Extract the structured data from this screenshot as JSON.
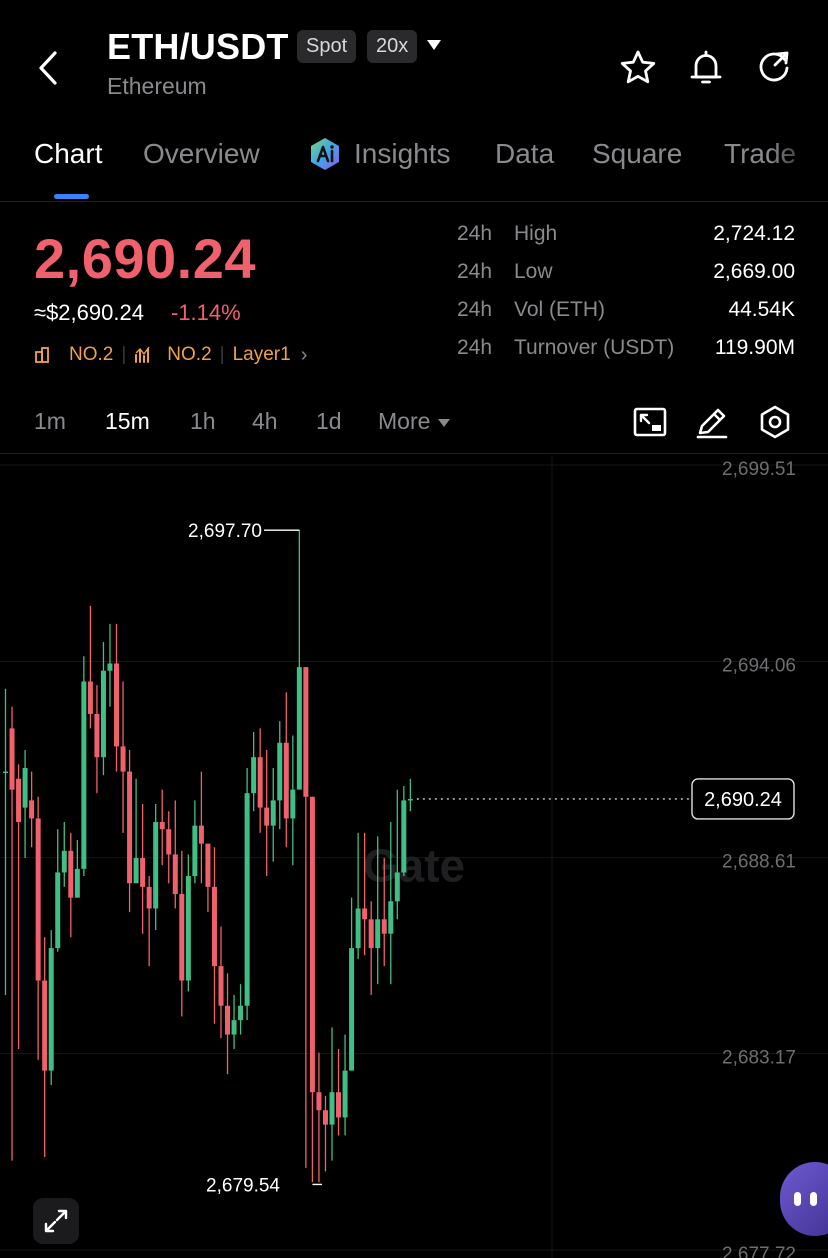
{
  "header": {
    "pair": "ETH/USDT",
    "market_badge": "Spot",
    "leverage_badge": "20x",
    "name": "Ethereum",
    "icons": [
      "back-arrow-icon",
      "star-icon",
      "bell-icon",
      "share-icon"
    ]
  },
  "tabs": [
    {
      "label": "Chart",
      "active": true
    },
    {
      "label": "Overview"
    },
    {
      "label": "Insights",
      "icon": "ai-icon"
    },
    {
      "label": "Data"
    },
    {
      "label": "Square"
    },
    {
      "label": "Trade"
    }
  ],
  "price": {
    "last": "2,690.24",
    "usd": "≈$2,690.24",
    "change_pct": "-1.14%",
    "rank_mcap": "NO.2",
    "rank_vol": "NO.2",
    "category": "Layer1",
    "down_color": "#f0616d",
    "up_color": "#3fbf85"
  },
  "stats": [
    {
      "period": "24h",
      "label": "High",
      "value": "2,724.12"
    },
    {
      "period": "24h",
      "label": "Low",
      "value": "2,669.00"
    },
    {
      "period": "24h",
      "label": "Vol (ETH)",
      "value": "44.54K"
    },
    {
      "period": "24h",
      "label": "Turnover (USDT)",
      "value": "119.90M"
    }
  ],
  "intervals": [
    {
      "label": "1m"
    },
    {
      "label": "15m",
      "active": true
    },
    {
      "label": "1h"
    },
    {
      "label": "4h"
    },
    {
      "label": "1d"
    },
    {
      "label": "More"
    }
  ],
  "toolbar_icons": [
    "indicator-icon",
    "draw-pencil-icon",
    "settings-hex-icon"
  ],
  "chart_data": {
    "type": "candlestick",
    "interval": "15m",
    "y_ticks": [
      "2,699.51",
      "2,694.06",
      "2,688.61",
      "2,683.17",
      "2,677.72"
    ],
    "ylim": [
      2677.72,
      2699.51
    ],
    "last_price_label": "2,690.24",
    "last_price": 2690.24,
    "high_marker": {
      "label": "2,697.70",
      "value": 2697.7
    },
    "low_marker": {
      "label": "2,679.54",
      "value": 2679.54
    },
    "watermark": "Gate",
    "candles": [
      [
        2691.0,
        2691.0,
        2693.3,
        2684.8
      ],
      [
        2692.2,
        2690.5,
        2692.8,
        2680.2
      ],
      [
        2690.8,
        2689.6,
        2691.2,
        2683.3
      ],
      [
        2690.0,
        2691.1,
        2691.6,
        2688.6
      ],
      [
        2690.2,
        2689.7,
        2691.0,
        2688.9
      ],
      [
        2689.7,
        2685.2,
        2690.3,
        2683.0
      ],
      [
        2685.2,
        2682.7,
        2686.4,
        2680.3
      ],
      [
        2682.7,
        2686.1,
        2686.6,
        2682.3
      ],
      [
        2686.1,
        2688.2,
        2689.4,
        2686.0
      ],
      [
        2688.2,
        2688.8,
        2689.6,
        2687.8
      ],
      [
        2688.8,
        2687.5,
        2689.3,
        2686.4
      ],
      [
        2687.5,
        2688.3,
        2689.1,
        2687.9
      ],
      [
        2688.3,
        2693.5,
        2694.2,
        2688.1
      ],
      [
        2693.5,
        2692.6,
        2695.6,
        2692.2
      ],
      [
        2692.6,
        2691.4,
        2693.4,
        2690.4
      ],
      [
        2691.4,
        2693.8,
        2694.6,
        2690.9
      ],
      [
        2693.8,
        2694.0,
        2695.1,
        2692.8
      ],
      [
        2694.0,
        2691.7,
        2695.1,
        2691.0
      ],
      [
        2691.7,
        2691.0,
        2693.5,
        2689.3
      ],
      [
        2691.0,
        2687.9,
        2691.6,
        2687.1
      ],
      [
        2687.9,
        2688.6,
        2690.8,
        2688.0
      ],
      [
        2688.6,
        2687.8,
        2690.1,
        2686.5
      ],
      [
        2687.8,
        2687.2,
        2688.1,
        2685.6
      ],
      [
        2687.2,
        2689.6,
        2690.1,
        2686.6
      ],
      [
        2689.6,
        2689.4,
        2690.5,
        2688.4
      ],
      [
        2689.4,
        2688.7,
        2689.9,
        2687.9
      ],
      [
        2688.7,
        2687.6,
        2690.2,
        2687.2
      ],
      [
        2687.6,
        2685.2,
        2688.8,
        2684.2
      ],
      [
        2685.2,
        2688.1,
        2688.7,
        2684.9
      ],
      [
        2688.1,
        2689.5,
        2690.2,
        2687.9
      ],
      [
        2689.5,
        2689.0,
        2691.0,
        2687.9
      ],
      [
        2689.0,
        2687.8,
        2688.9,
        2687.1
      ],
      [
        2687.8,
        2685.6,
        2688.9,
        2684.0
      ],
      [
        2685.6,
        2684.5,
        2686.7,
        2683.6
      ],
      [
        2684.5,
        2683.7,
        2685.4,
        2682.6
      ],
      [
        2683.7,
        2684.1,
        2684.8,
        2683.3
      ],
      [
        2684.1,
        2684.5,
        2685.1,
        2683.7
      ],
      [
        2684.5,
        2690.4,
        2691.1,
        2684.1
      ],
      [
        2690.4,
        2691.4,
        2692.1,
        2689.9
      ],
      [
        2691.4,
        2690.0,
        2692.2,
        2689.3
      ],
      [
        2690.0,
        2689.5,
        2691.6,
        2688.1
      ],
      [
        2689.5,
        2690.2,
        2691.1,
        2688.5
      ],
      [
        2690.2,
        2691.8,
        2692.4,
        2689.4
      ],
      [
        2691.8,
        2689.7,
        2693.2,
        2688.9
      ],
      [
        2689.7,
        2690.5,
        2692.0,
        2688.4
      ],
      [
        2690.5,
        2693.9,
        2697.7,
        2690.5
      ],
      [
        2693.9,
        2690.3,
        2693.9,
        2680.0
      ],
      [
        2690.3,
        2682.1,
        2690.3,
        2679.6
      ],
      [
        2682.1,
        2681.6,
        2683.2,
        2679.6
      ],
      [
        2681.6,
        2681.2,
        2682.0,
        2679.9
      ],
      [
        2681.2,
        2682.1,
        2683.9,
        2680.2
      ],
      [
        2682.1,
        2681.4,
        2683.3,
        2680.9
      ],
      [
        2681.4,
        2682.7,
        2683.7,
        2680.9
      ],
      [
        2682.7,
        2686.1,
        2687.5,
        2682.7
      ],
      [
        2686.1,
        2687.2,
        2689.3,
        2685.8
      ],
      [
        2687.2,
        2686.9,
        2689.3,
        2685.9
      ],
      [
        2686.9,
        2686.1,
        2687.4,
        2684.8
      ],
      [
        2686.1,
        2686.9,
        2689.2,
        2685.1
      ],
      [
        2686.9,
        2686.5,
        2688.6,
        2685.6
      ],
      [
        2686.5,
        2687.4,
        2689.6,
        2685.1
      ],
      [
        2687.4,
        2688.2,
        2690.5,
        2686.9
      ],
      [
        2688.2,
        2690.2,
        2690.6,
        2688.1
      ],
      [
        2690.2,
        2690.24,
        2690.8,
        2689.9
      ]
    ]
  }
}
